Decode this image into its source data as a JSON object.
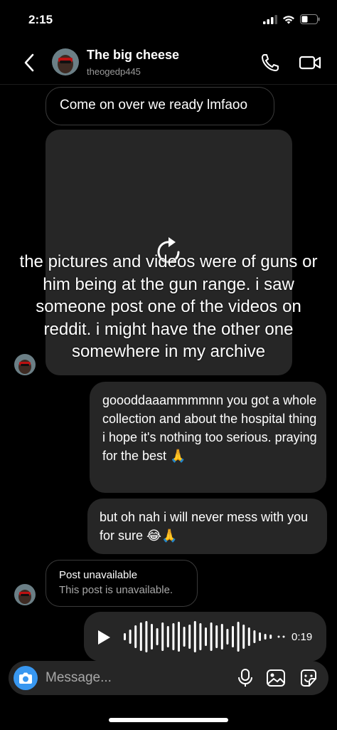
{
  "status": {
    "time": "2:15"
  },
  "header": {
    "name": "The big cheese",
    "username": "theogedp445"
  },
  "messages": {
    "m1": "Come on over we ready lmfaoo",
    "m2": "goooddaaammmmnn you got a whole collection and about the hospital thing i hope it's nothing too serious. praying for the best 🙏",
    "m3": "but oh nah i will never mess with you for sure 😂🙏"
  },
  "overlay_caption": "the pictures and videos were of guns or him being at the gun range. i saw someone post one of the videos on reddit. i might have the other one somewhere in my archive",
  "post": {
    "title": "Post unavailable",
    "subtitle": "This post is unavailable."
  },
  "voice": {
    "duration": "0:19"
  },
  "composer": {
    "placeholder": "Message..."
  },
  "icons": [
    "back-icon",
    "voice-call-icon",
    "video-call-icon",
    "replay-icon",
    "play-icon",
    "camera-icon",
    "microphone-icon",
    "gallery-icon",
    "sticker-icon",
    "signal-icon",
    "wifi-icon",
    "battery-icon"
  ],
  "colors": {
    "background": "#000000",
    "bubble": "#262626",
    "accent": "#3897f0",
    "secondary_text": "#a8a8a8"
  }
}
